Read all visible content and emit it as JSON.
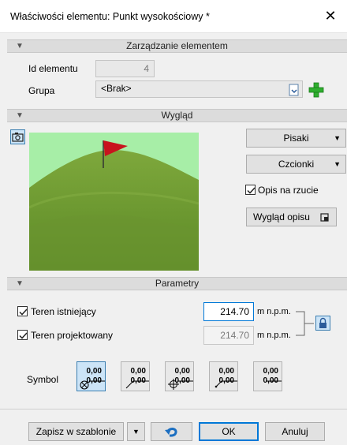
{
  "window": {
    "title": "Właściwości elementu: Punkt wysokościowy *",
    "close_glyph": "✕"
  },
  "sections": {
    "management": "Zarządzanie elementem",
    "appearance": "Wygląd",
    "parameters": "Parametry"
  },
  "management": {
    "id_label": "Id elementu",
    "id_value": "4",
    "group_label": "Grupa",
    "group_value": "<Brak>"
  },
  "appearance": {
    "pens_button": "Pisaki",
    "fonts_button": "Czcionki",
    "description_on_projection_label": "Opis na rzucie",
    "description_on_projection_checked": true,
    "description_style_button": "Wygląd opisu"
  },
  "parameters": {
    "existing_terrain_label": "Teren istniejący",
    "existing_terrain_checked": true,
    "existing_terrain_value": "214.70",
    "existing_terrain_unit": "m n.p.m.",
    "designed_terrain_label": "Teren projektowany",
    "designed_terrain_checked": true,
    "designed_terrain_value": "214.70",
    "designed_terrain_unit": "m n.p.m.",
    "symbol_label": "Symbol",
    "symbols": [
      {
        "top": "0,00",
        "bottom": "0,00",
        "icon": "circle-x-icon",
        "selected": true
      },
      {
        "top": "0,00",
        "bottom": "0,00",
        "icon": "slash-icon",
        "selected": false
      },
      {
        "top": "0,00",
        "bottom": "0,00",
        "icon": "circle-cross-icon",
        "selected": false
      },
      {
        "top": "0,00",
        "bottom": "0,00",
        "icon": "dot-icon",
        "selected": false
      },
      {
        "top": "0,00",
        "bottom": "0,00",
        "icon": "blank-icon",
        "selected": false
      }
    ]
  },
  "footer": {
    "save_template_button": "Zapisz w szablonie",
    "ok_button": "OK",
    "cancel_button": "Anuluj"
  },
  "colors": {
    "accent": "#0078d7",
    "flag": "#c8141e",
    "grass": "#6f9a2f",
    "sky": "#a7eea7"
  }
}
